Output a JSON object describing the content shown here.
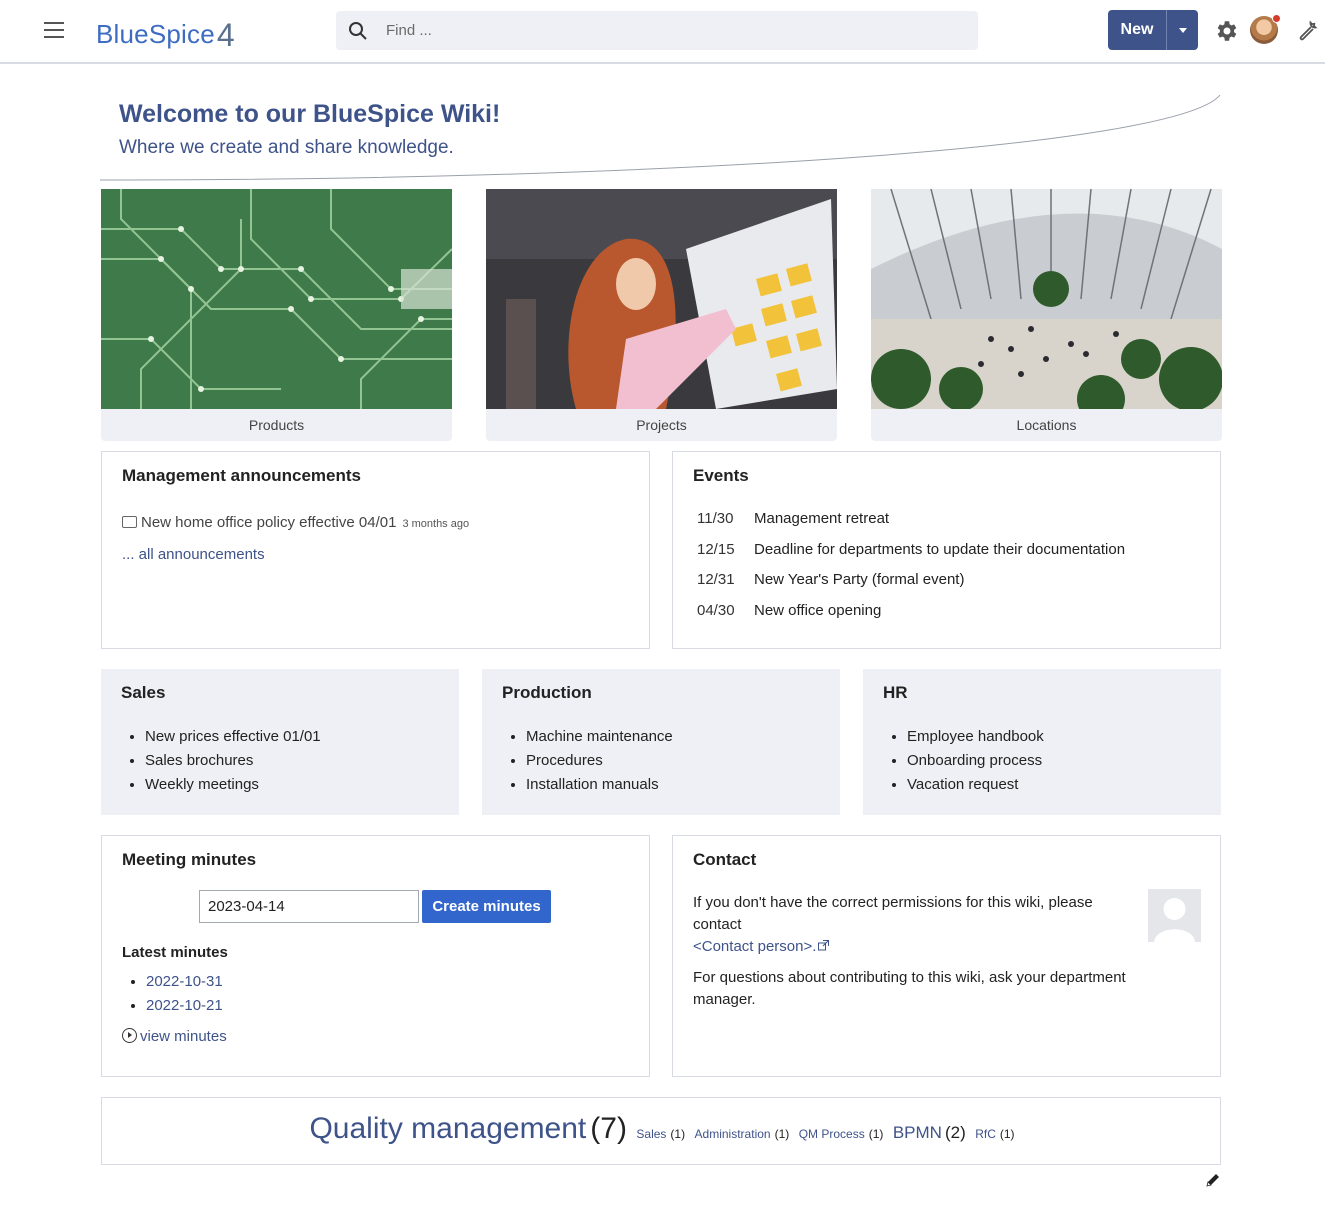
{
  "header": {
    "logo_text": "BlueSpice",
    "logo_number": "4",
    "search_placeholder": "Find ...",
    "new_label": "New"
  },
  "welcome": {
    "title": "Welcome to our BlueSpice Wiki!",
    "subtitle": "Where we create and share knowledge."
  },
  "cards": [
    {
      "caption": "Products"
    },
    {
      "caption": "Projects"
    },
    {
      "caption": "Locations"
    }
  ],
  "announcements": {
    "title": "Management announcements",
    "item": "New home office policy effective 04/01",
    "item_age": "3 months ago",
    "all_link": "... all announcements"
  },
  "events": {
    "title": "Events",
    "items": [
      {
        "date": "11/30",
        "text": "Management retreat"
      },
      {
        "date": "12/15",
        "text": "Deadline for departments to update their documentation"
      },
      {
        "date": "12/31",
        "text": "New Year's Party (formal event)"
      },
      {
        "date": "04/30",
        "text": "New office opening"
      }
    ]
  },
  "departments": [
    {
      "title": "Sales",
      "items": [
        "New prices effective 01/01",
        "Sales brochures",
        "Weekly meetings"
      ]
    },
    {
      "title": "Production",
      "items": [
        "Machine maintenance",
        "Procedures",
        "Installation manuals"
      ]
    },
    {
      "title": "HR",
      "items": [
        "Employee handbook",
        "Onboarding process",
        "Vacation request"
      ]
    }
  ],
  "minutes": {
    "title": "Meeting minutes",
    "date_value": "2023-04-14",
    "create_label": "Create minutes",
    "latest_label": "Latest minutes",
    "latest": [
      "2022-10-31",
      "2022-10-21"
    ],
    "view_label": "view minutes"
  },
  "contact": {
    "title": "Contact",
    "text1": "If you don't have the correct permissions for this wiki, please contact",
    "link": "<Contact person>.",
    "text2": "For questions about contributing to this wiki, ask your department manager."
  },
  "quality": {
    "main": "Quality management",
    "main_count": "(7)",
    "tags": [
      {
        "label": "Sales",
        "count": "(1)",
        "size": "sm"
      },
      {
        "label": "Administration",
        "count": "(1)",
        "size": "sm"
      },
      {
        "label": "QM Process",
        "count": "(1)",
        "size": "sm"
      },
      {
        "label": "BPMN",
        "count": "(2)",
        "size": "md"
      },
      {
        "label": "RfC",
        "count": "(1)",
        "size": "sm"
      }
    ]
  },
  "colors": {
    "primary": "#3e5389",
    "accent_button": "#3366cc",
    "panel_gray": "#eef0f5"
  }
}
